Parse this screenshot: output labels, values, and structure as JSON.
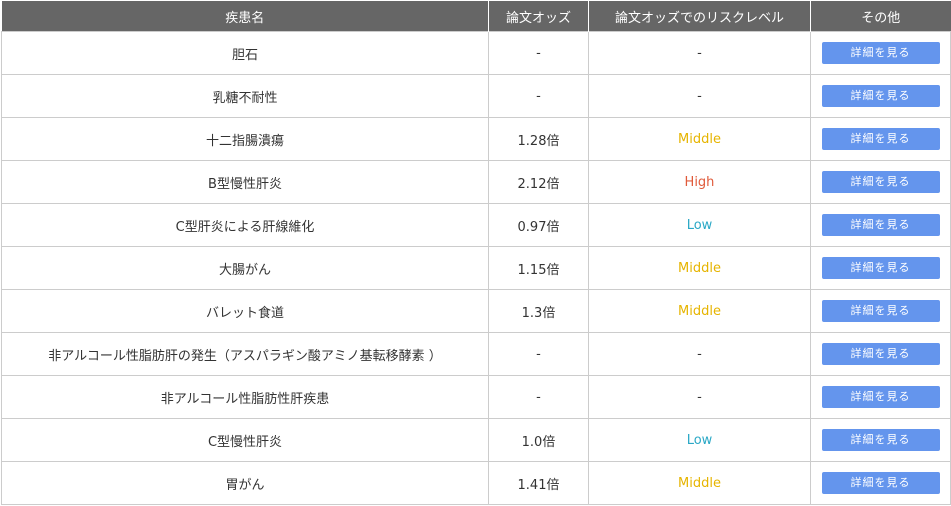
{
  "headers": [
    "疾患名",
    "論文オッズ",
    "論文オッズでのリスクレベル",
    "その他"
  ],
  "button_label": "詳細を見る",
  "level_colors": {
    "Middle": "#e6b400",
    "High": "#e05a3a",
    "Low": "#2aa8c6",
    "-": "#333333"
  },
  "rows": [
    {
      "name": "胆石",
      "odds": "-",
      "level": "-"
    },
    {
      "name": "乳糖不耐性",
      "odds": "-",
      "level": "-"
    },
    {
      "name": "十二指腸潰瘍",
      "odds": "1.28倍",
      "level": "Middle"
    },
    {
      "name": "B型慢性肝炎",
      "odds": "2.12倍",
      "level": "High"
    },
    {
      "name": "C型肝炎による肝線維化",
      "odds": "0.97倍",
      "level": "Low"
    },
    {
      "name": "大腸がん",
      "odds": "1.15倍",
      "level": "Middle"
    },
    {
      "name": "バレット食道",
      "odds": "1.3倍",
      "level": "Middle"
    },
    {
      "name": "非アルコール性脂肪肝の発生（アスパラギン酸アミノ基転移酵素 ）",
      "odds": "-",
      "level": "-"
    },
    {
      "name": "非アルコール性脂肪性肝疾患",
      "odds": "-",
      "level": "-"
    },
    {
      "name": "C型慢性肝炎",
      "odds": "1.0倍",
      "level": "Low"
    },
    {
      "name": "胃がん",
      "odds": "1.41倍",
      "level": "Middle"
    }
  ]
}
